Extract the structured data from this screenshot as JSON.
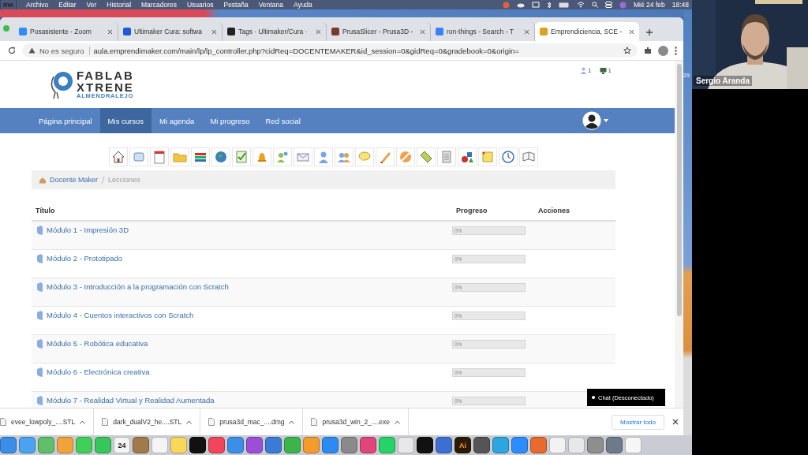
{
  "menubar": {
    "app": "me",
    "menus": [
      "Archivo",
      "Editar",
      "Ver",
      "Historial",
      "Marcadores",
      "Usuarios",
      "Pestaña",
      "Ventana",
      "Ayuda"
    ],
    "date": "Mié 24 feb",
    "time": "18:48"
  },
  "desktop": {
    "edge_text": "29"
  },
  "browser": {
    "tabs": [
      {
        "title": "Posasistente - Zoom",
        "selected": false,
        "color": "#2d8cff"
      },
      {
        "title": "Ultimaker Cura: softwa",
        "selected": false,
        "color": "#1e5bd6"
      },
      {
        "title": "Tags · Ultimaker/Cura ·",
        "selected": false,
        "color": "#222222"
      },
      {
        "title": "PrusaSlicer - Prusa3D -",
        "selected": false,
        "color": "#7a3b2e"
      },
      {
        "title": "ron-things - Search - T",
        "selected": false,
        "color": "#3b82f6"
      },
      {
        "title": "Emprendiciencia, SCE -",
        "selected": true,
        "color": "#e0a020"
      }
    ],
    "address": {
      "security": "No es seguro",
      "url": "aula.emprendimaker.com/main/lp/lp_controller.php?cidReq=DOCENTEMAKER&id_session=0&gidReq=0&gradebook=0&origin="
    }
  },
  "site": {
    "logo": {
      "line1": "FABLAB",
      "line2": "XTRENE",
      "line3": "ALMENDRALEJO"
    },
    "counters": [
      "1",
      "1"
    ],
    "nav": [
      {
        "label": "Página principal",
        "selected": false
      },
      {
        "label": "Mis cursos",
        "selected": true
      },
      {
        "label": "Mi agenda",
        "selected": false
      },
      {
        "label": "Mi progreso",
        "selected": false
      },
      {
        "label": "Red social",
        "selected": false
      }
    ],
    "breadcrumb": [
      "Docente Maker",
      "Lecciones"
    ],
    "table": {
      "columns": [
        "Título",
        "Progreso",
        "Acciones"
      ],
      "rows": [
        {
          "title": "Módulo 1 - Impresión 3D",
          "progress": "0%",
          "level": 0
        },
        {
          "title": "Módulo 2 - Prototipado",
          "progress": "0%",
          "level": 0
        },
        {
          "title": "Módulo 3 - Introducción a la programación con Scratch",
          "progress": "0%",
          "level": 0
        },
        {
          "title": "Módulo 4 - Cuentos interactivos con Scratch",
          "progress": "0%",
          "level": 0
        },
        {
          "title": "Módulo 5 - Robótica educativa",
          "progress": "0%",
          "level": 0
        },
        {
          "title": "Módulo 6 - Electrónica creativa",
          "progress": "0%",
          "level": 0
        },
        {
          "title": "Módulo 7 - Realidad Virtual y Realidad Aumentada",
          "progress": "0%",
          "level": 0
        }
      ]
    }
  },
  "chat": {
    "label": "Chat (Desconectado)"
  },
  "downloads": {
    "items": [
      "evee_lowpoly_....STL",
      "dark_dualV2_he....STL",
      "prusa3d_mac_....dmg",
      "prusa3d_win_2_....exe"
    ],
    "show_all": "Mostrar todo"
  },
  "dock": {
    "apps": [
      {
        "color": "#3a8ee6"
      },
      {
        "color": "#4aa3f0"
      },
      {
        "color": "#5fbf6a"
      },
      {
        "color": "#f2a23c"
      },
      {
        "color": "#3fcf5a"
      },
      {
        "color": "#35c759"
      },
      {
        "color": "#f4f4f4",
        "label": "24"
      },
      {
        "color": "#a07a4a"
      },
      {
        "color": "#f4f4f4"
      },
      {
        "color": "#f7d85a"
      },
      {
        "color": "#111111"
      },
      {
        "color": "#f0455a"
      },
      {
        "color": "#3b8fe8"
      },
      {
        "color": "#9a4fd6"
      },
      {
        "color": "#3a7bd5"
      },
      {
        "color": "#3cb44b"
      },
      {
        "color": "#f59a2c"
      },
      {
        "color": "#2b8cf0"
      },
      {
        "color": "#8a8a8a"
      },
      {
        "color": "#e0457b"
      },
      {
        "color": "#25d366"
      },
      {
        "color": "#e8e8e8"
      },
      {
        "color": "#111111"
      },
      {
        "color": "#3b6fd0"
      },
      {
        "color": "#2a1a05",
        "label": "Ai"
      },
      {
        "color": "#555555"
      },
      {
        "color": "#2ca5e0"
      },
      {
        "color": "#2d8cff"
      },
      {
        "color": "#e86a2c"
      },
      {
        "color": "#f2f2f2"
      },
      {
        "color": "#e8e8e8"
      },
      {
        "color": "#8e8e8e"
      },
      {
        "color": "#6e7a8a"
      },
      {
        "color": "#f6f6f6"
      }
    ]
  },
  "video": {
    "name": "Sergio Aranda"
  }
}
